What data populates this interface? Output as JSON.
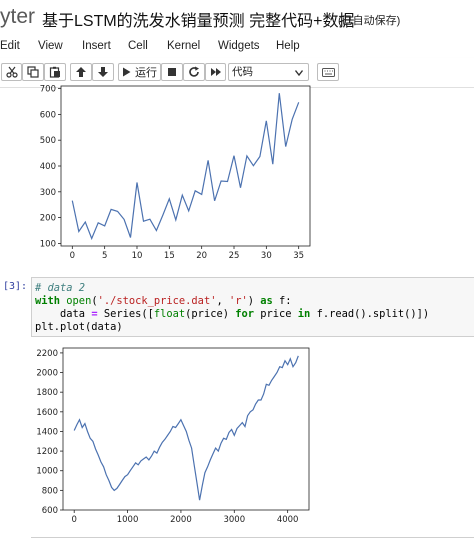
{
  "header": {
    "brand": "yter",
    "notebook_title": "基于LSTM的洗发水销量预测 完整代码+数据",
    "autosave": "(已自动保存)"
  },
  "menu": [
    "Edit",
    "View",
    "Insert",
    "Cell",
    "Kernel",
    "Widgets",
    "Help"
  ],
  "toolbar": {
    "run_label": "运行",
    "cell_type": "代码",
    "icons": [
      "cut-icon",
      "copy-icon",
      "paste-icon",
      "move-up-icon",
      "move-down-icon",
      "run-icon",
      "stop-icon",
      "restart-icon",
      "keyboard-icon"
    ]
  },
  "cells": {
    "code_prompt": "[3]:",
    "code_lines": [
      "# data 2",
      "with open('./stock_price.dat', 'r') as f:",
      "    data = Series([float(price) for price in f.read().split()])",
      "plt.plot(data)"
    ]
  },
  "chart_data": [
    {
      "type": "line",
      "title": "",
      "xlabel": "",
      "ylabel": "",
      "x_ticks": [
        0,
        5,
        10,
        15,
        20,
        25,
        30,
        35
      ],
      "y_ticks": [
        100,
        200,
        300,
        400,
        500,
        600,
        700
      ],
      "xlim": [
        -1.75,
        36.75
      ],
      "ylim": [
        90,
        710
      ],
      "color": "#4c72b0",
      "grid": false,
      "values": [
        266,
        146,
        183,
        119,
        180,
        168,
        232,
        224,
        193,
        123,
        336,
        186,
        194,
        150,
        210,
        273,
        191,
        287,
        226,
        304,
        290,
        422,
        265,
        342,
        340,
        440,
        316,
        439,
        401,
        437,
        575,
        407,
        682,
        475,
        581,
        647
      ]
    },
    {
      "type": "line",
      "title": "",
      "xlabel": "",
      "ylabel": "",
      "x_ticks": [
        0,
        1000,
        2000,
        3000,
        4000
      ],
      "y_ticks": [
        600,
        800,
        1000,
        1200,
        1400,
        1600,
        1800,
        2000,
        2200
      ],
      "xlim": [
        -210,
        4400
      ],
      "ylim": [
        600,
        2250
      ],
      "color": "#4c72b0",
      "grid": false,
      "x": [
        0,
        50,
        100,
        150,
        200,
        250,
        300,
        350,
        400,
        450,
        500,
        550,
        600,
        650,
        700,
        750,
        800,
        850,
        900,
        950,
        1000,
        1050,
        1100,
        1150,
        1200,
        1250,
        1300,
        1350,
        1400,
        1450,
        1500,
        1550,
        1600,
        1650,
        1700,
        1750,
        1800,
        1850,
        1900,
        1950,
        2000,
        2050,
        2100,
        2150,
        2200,
        2250,
        2300,
        2350,
        2400,
        2450,
        2500,
        2550,
        2600,
        2650,
        2700,
        2750,
        2800,
        2850,
        2900,
        2950,
        3000,
        3050,
        3100,
        3150,
        3200,
        3250,
        3300,
        3350,
        3400,
        3450,
        3500,
        3550,
        3600,
        3650,
        3700,
        3750,
        3800,
        3850,
        3900,
        3950,
        4000,
        4050,
        4100,
        4150,
        4200
      ],
      "values": [
        1410,
        1470,
        1520,
        1440,
        1480,
        1400,
        1330,
        1300,
        1220,
        1160,
        1090,
        1040,
        960,
        900,
        830,
        800,
        820,
        860,
        900,
        940,
        960,
        1000,
        1040,
        1080,
        1060,
        1100,
        1120,
        1140,
        1110,
        1150,
        1200,
        1180,
        1240,
        1290,
        1320,
        1360,
        1400,
        1450,
        1440,
        1480,
        1520,
        1460,
        1400,
        1310,
        1230,
        1050,
        880,
        700,
        850,
        980,
        1040,
        1110,
        1170,
        1230,
        1200,
        1280,
        1330,
        1320,
        1390,
        1420,
        1360,
        1430,
        1460,
        1490,
        1450,
        1560,
        1600,
        1620,
        1680,
        1720,
        1720,
        1780,
        1880,
        1870,
        1920,
        1960,
        2000,
        2060,
        2050,
        2120,
        2080,
        2140,
        2060,
        2100,
        2170
      ]
    }
  ]
}
